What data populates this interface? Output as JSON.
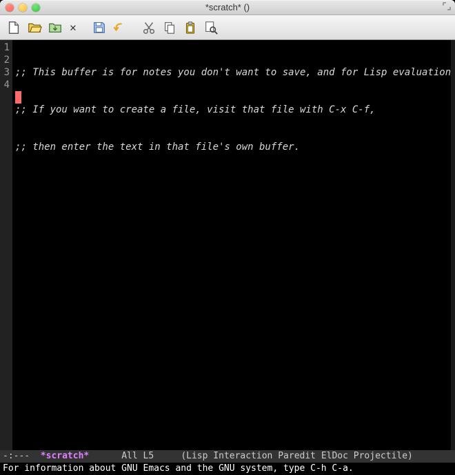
{
  "window": {
    "title": "*scratch* ()"
  },
  "toolbar": {
    "new_file": "New",
    "open_file": "Open",
    "save_file": "Save",
    "close_x": "✕",
    "diskette": "Save As",
    "undo": "Undo",
    "cut": "Cut",
    "copy": "Copy",
    "paste": "Paste",
    "search": "Search"
  },
  "editor": {
    "line_numbers": [
      "1",
      "2",
      "3",
      "4"
    ],
    "lines": [
      ";; This buffer is for notes you don't want to save, and for Lisp evaluation.",
      ";; If you want to create a file, visit that file with C-x C-f,",
      ";; then enter the text in that file's own buffer.",
      ""
    ],
    "cursor": {
      "line": 4,
      "col": 0
    }
  },
  "modeline": {
    "left": "-:---",
    "buffer": "*scratch*",
    "position": "All L5",
    "modes": "(Lisp Interaction Paredit ElDoc Projectile)"
  },
  "minibuffer": {
    "message": "For information about GNU Emacs and the GNU system, type C-h C-a."
  }
}
